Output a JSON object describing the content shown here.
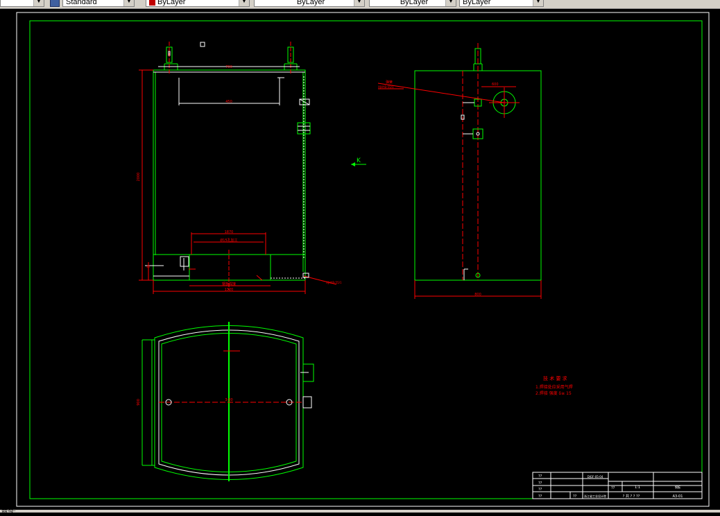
{
  "toolbar": {
    "textstyle_combo": "Standard",
    "color_combo": "ByLayer",
    "layer_combo": "ByLayer",
    "linetype_combo": "ByLayer",
    "lineweight_combo": "ByLayer"
  },
  "drawing": {
    "view_label": "K",
    "front_dims": {
      "top_width": "700",
      "inner_width": "450",
      "height": "2000",
      "slot_width": "1870",
      "slot_detail": "Ø15孔加工",
      "bottom_detail": "钢板焊接",
      "total_width": "1320",
      "note_label": "A 1"
    },
    "side_dims": {
      "top_label": "弹簧",
      "top_code": "XJHYB-55/1",
      "circle_dim": "600",
      "bottom_width": "800"
    },
    "plan_dims": {
      "side_height": "900",
      "center_label": "3-80"
    },
    "tech_notes": {
      "title": "技 术 要 求",
      "line1": "1.焊接处应采用气焊",
      "line2": "2.焊接 强度 δ≥ 15"
    },
    "title_block": {
      "drawing_no": "DJGF-05-04",
      "scale": "1:1",
      "material": "钢板",
      "company": "浙江省工业设计院",
      "sheet": "A3-01",
      "row_labels": [
        "??",
        "??",
        "??",
        "??"
      ],
      "mid_label1": "??",
      "mid_label2": "??",
      "sheet_info": "? 共 ? ? ??"
    }
  },
  "status": {
    "command_prefix": "命令:"
  },
  "colors": {
    "background": "#000000",
    "outline": "#00ff00",
    "dimension": "#ff0000",
    "text": "#ffffff"
  }
}
